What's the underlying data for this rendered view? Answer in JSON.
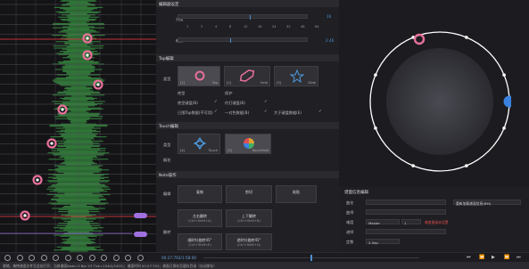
{
  "editor_settings": {
    "header": "编辑器设定",
    "beat_label": "分度",
    "zoom_label": "缩放",
    "beat_value": "16",
    "zoom_value": "2.46",
    "beat_ticks": [
      "1",
      "2",
      "4",
      "8",
      "12",
      "16",
      "24",
      "32",
      "48",
      "64"
    ],
    "beat_level": 0.55,
    "zoom_level": 0.4
  },
  "tap_edit": {
    "header": "Tap编辑",
    "type_label": "类型",
    "types": [
      {
        "key": "[1]",
        "name": "Tap",
        "selected": true
      },
      {
        "key": "[2]",
        "name": "Hold",
        "selected": false
      },
      {
        "key": "[3]",
        "name": "Slide",
        "selected": false
      }
    ],
    "options": [
      {
        "label": "绝型",
        "label2": "保护",
        "checked": false,
        "checked2": false
      },
      {
        "label": "绝型键盘(B)",
        "label2": "约打键盘(B)",
        "checked": true,
        "checked2": true
      },
      {
        "label": "已限Tap数据(不可用)",
        "label2": "一对色数据(B)",
        "checked": true,
        "checked2": true,
        "label3": "大于键盘数据(E)",
        "checked3": true
      }
    ]
  },
  "touch_edit": {
    "header": "Touch编辑",
    "type_label": "类型",
    "types": [
      {
        "key": "[4]",
        "name": "Touch",
        "selected": false
      },
      {
        "key": "[5]",
        "name": "TouchHold",
        "selected": true
      }
    ],
    "extra_label": "烟花"
  },
  "note_ops": {
    "header": "Note操作",
    "edit_label": "编辑",
    "flip_label": "翻转",
    "buttons": [
      {
        "label": "复制",
        "shortcut": ""
      },
      {
        "label": "剪切",
        "shortcut": ""
      },
      {
        "label": "粘贴",
        "shortcut": ""
      },
      {
        "label": "左右翻转",
        "shortcut": "(Ctrl+Shift+A)"
      },
      {
        "label": "上下翻转",
        "shortcut": "(Ctrl+Shift+B)"
      },
      {
        "label": "顺时针旋转45°",
        "shortcut": "(Ctrl+Shift+E)"
      },
      {
        "label": "逆时针旋转45°",
        "shortcut": "(Ctrl+Shift+Q)"
      }
    ]
  },
  "song_info": {
    "header": "谱面信息编辑",
    "labels": [
      "曲名",
      "曲师",
      "难度",
      "谱师",
      "定数"
    ],
    "difficulty_value": "Master",
    "level_value": "1",
    "level_note": "难度星级未设置",
    "const_value": "2.5ep",
    "btn_open": "重新加载谱面信息(BM)"
  },
  "timeline_text": "00:27:793/1:58:00",
  "status_text": "就绪。拖拽谱面文件至此处打开；当前谱面Beat=3 Bar 23 Tick=1540(/1920)；谱面时间 00:27:793；谱面已保存至缓存目录（自动保存）",
  "colors": {
    "accent": "#4d8fd0",
    "note_pink": "#e8709a",
    "waveform": "#3fa84a",
    "red_line": "#c03038",
    "ring_white": "#ffffff",
    "ring_blue": "#3b82e0"
  },
  "icons": {
    "tap": "pink-ring-icon",
    "hold": "pink-hexagon-icon",
    "slide": "blue-star-icon",
    "touch": "blue-sparkle-icon",
    "touchhold": "rainbow-circle-icon"
  }
}
